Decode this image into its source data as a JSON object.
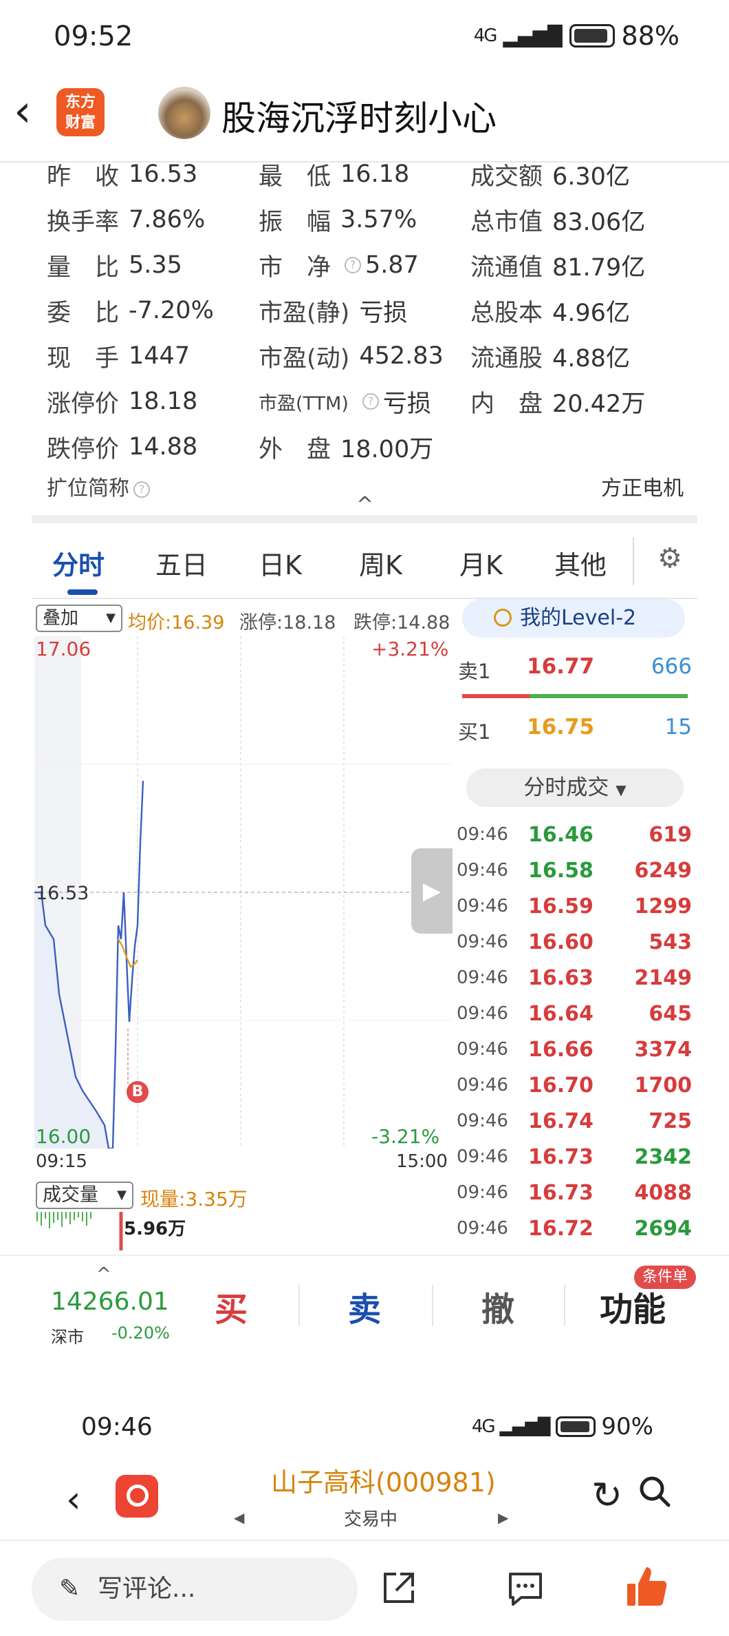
{
  "status_bar": {
    "time": "09:52",
    "signal": "4G",
    "battery": "88%"
  },
  "post_header": {
    "app_logo": "东方\n财富",
    "username": "股海沉浮时刻小心"
  },
  "quote": {
    "rows": [
      [
        {
          "label": "昨　收",
          "value": "16.53"
        },
        {
          "label": "最　低",
          "value": "16.18"
        },
        {
          "label": "成交额",
          "value": "6.30亿"
        }
      ],
      [
        {
          "label": "换手率",
          "value": "7.86%"
        },
        {
          "label": "振　幅",
          "value": "3.57%"
        },
        {
          "label": "总市值",
          "value": "83.06亿"
        }
      ],
      [
        {
          "label": "量　比",
          "value": "5.35"
        },
        {
          "label": "市　净",
          "value": "5.87"
        },
        {
          "label": "流通值",
          "value": "81.79亿"
        }
      ],
      [
        {
          "label": "委　比",
          "value": "-7.20%"
        },
        {
          "label": "市盈(静)",
          "value": "亏损"
        },
        {
          "label": "总股本",
          "value": "4.96亿"
        }
      ],
      [
        {
          "label": "现　手",
          "value": "1447"
        },
        {
          "label": "市盈(动)",
          "value": "452.83"
        },
        {
          "label": "流通股",
          "value": "4.88亿"
        }
      ],
      [
        {
          "label": "涨停价",
          "value": "18.18"
        },
        {
          "label": "市盈(TTM)",
          "value": "亏损"
        },
        {
          "label": "内　盘",
          "value": "20.42万"
        }
      ],
      [
        {
          "label": "跌停价",
          "value": "14.88"
        },
        {
          "label": "外　盘",
          "value": "18.00万"
        },
        {
          "label": "",
          "value": ""
        }
      ]
    ],
    "expand_label": "扩位简称",
    "expand_value": "方正电机",
    "collapse_glyph": "^"
  },
  "chart_tabs": [
    "分时",
    "五日",
    "日K",
    "周K",
    "月K",
    "其他"
  ],
  "chart_info": {
    "overlay_label": "叠加",
    "avg": "均价:16.39",
    "limit_up": "涨停:18.18",
    "limit_down": "跌停:14.88",
    "level2": "我的Level-2"
  },
  "chart_axes": {
    "top_price": "17.06",
    "top_pct": "+3.21%",
    "prev_close": "16.53",
    "bottom_price": "16.00",
    "bottom_pct": "-3.21%",
    "time_start": "09:15",
    "time_end": "15:00",
    "trade_marker": "B"
  },
  "volume": {
    "selector": "成交量",
    "current": "现量:3.35万",
    "max": "5.96万"
  },
  "order_book": {
    "sell": {
      "label": "卖1",
      "price": "16.77",
      "volume": "666"
    },
    "buy": {
      "label": "买1",
      "price": "16.75",
      "volume": "15"
    },
    "ticks_button": "分时成交",
    "ticks": [
      {
        "time": "09:46",
        "price": "16.46",
        "vol": "619",
        "pc": "g",
        "vc": "r"
      },
      {
        "time": "09:46",
        "price": "16.58",
        "vol": "6249",
        "pc": "g",
        "vc": "r"
      },
      {
        "time": "09:46",
        "price": "16.59",
        "vol": "1299",
        "pc": "r",
        "vc": "r"
      },
      {
        "time": "09:46",
        "price": "16.60",
        "vol": "543",
        "pc": "r",
        "vc": "r"
      },
      {
        "time": "09:46",
        "price": "16.63",
        "vol": "2149",
        "pc": "r",
        "vc": "r"
      },
      {
        "time": "09:46",
        "price": "16.64",
        "vol": "645",
        "pc": "r",
        "vc": "r"
      },
      {
        "time": "09:46",
        "price": "16.66",
        "vol": "3374",
        "pc": "r",
        "vc": "r"
      },
      {
        "time": "09:46",
        "price": "16.70",
        "vol": "1700",
        "pc": "r",
        "vc": "r"
      },
      {
        "time": "09:46",
        "price": "16.74",
        "vol": "725",
        "pc": "r",
        "vc": "r"
      },
      {
        "time": "09:46",
        "price": "16.73",
        "vol": "2342",
        "pc": "r",
        "vc": "g"
      },
      {
        "time": "09:46",
        "price": "16.73",
        "vol": "4088",
        "pc": "r",
        "vc": "r"
      },
      {
        "time": "09:46",
        "price": "16.72",
        "vol": "2694",
        "pc": "r",
        "vc": "g"
      }
    ]
  },
  "trade_bar": {
    "index_value": "14266.01",
    "index_name": "深市",
    "index_change": "-0.20%",
    "buy": "买",
    "sell": "卖",
    "cancel": "撤",
    "more": "功能",
    "badge": "条件单"
  },
  "status_bar2": {
    "time": "09:46",
    "signal": "4G",
    "battery": "90%"
  },
  "stock_header": {
    "name": "山子高科(000981)",
    "status": "交易中"
  },
  "comment_bar": {
    "placeholder": "写评论..."
  },
  "colors": {
    "up": "#d63c3c",
    "down": "#2a9a3c",
    "accent": "#1a4fb0",
    "avg_line": "#d6830c"
  }
}
